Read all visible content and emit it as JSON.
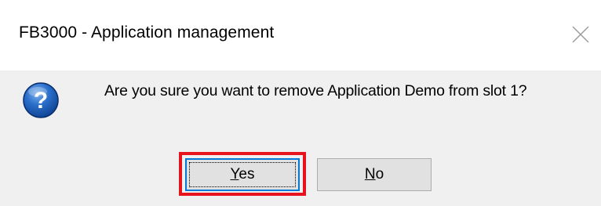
{
  "dialog": {
    "title": "FB3000 - Application management",
    "message": "Are you sure you want to remove Application Demo from slot 1?",
    "icon": "question-icon",
    "buttons": {
      "yes": {
        "mnemonic": "Y",
        "rest": "es"
      },
      "no": {
        "mnemonic": "N",
        "rest": "o"
      }
    },
    "highlighted_button": "yes"
  },
  "colors": {
    "titlebar_bg": "#ffffff",
    "body_bg": "#f0f0f0",
    "button_bg": "#e1e1e1",
    "focus_border": "#0078d7",
    "highlight": "#e8141d",
    "icon_blue": "#1f5fb8"
  }
}
